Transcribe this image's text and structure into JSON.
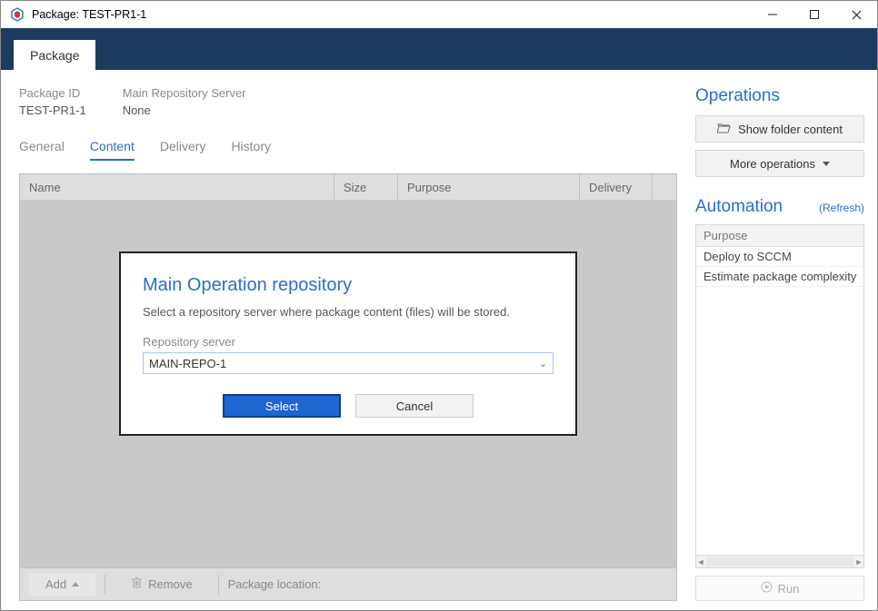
{
  "window": {
    "title": "Package: TEST-PR1-1"
  },
  "navbar": {
    "tab": "Package"
  },
  "details": {
    "package_id_label": "Package ID",
    "package_id_value": "TEST-PR1-1",
    "main_repo_label": "Main Repository Server",
    "main_repo_value": "None"
  },
  "subtabs": {
    "general": "General",
    "content": "Content",
    "delivery": "Delivery",
    "history": "History"
  },
  "table": {
    "headers": {
      "name": "Name",
      "size": "Size",
      "purpose": "Purpose",
      "delivery": "Delivery"
    }
  },
  "bottom": {
    "add": "Add",
    "remove": "Remove",
    "location_label": "Package location:"
  },
  "operations": {
    "title": "Operations",
    "show_folder": "Show folder content",
    "more": "More operations"
  },
  "automation": {
    "title": "Automation",
    "refresh": "(Refresh)",
    "header": "Purpose",
    "rows": [
      "Deploy to SCCM",
      "Estimate package complexity"
    ],
    "run": "Run"
  },
  "dialog": {
    "title": "Main Operation repository",
    "desc": "Select a repository server where package content (files) will be stored.",
    "field_label": "Repository server",
    "combo_value": "MAIN-REPO-1",
    "select": "Select",
    "cancel": "Cancel"
  }
}
